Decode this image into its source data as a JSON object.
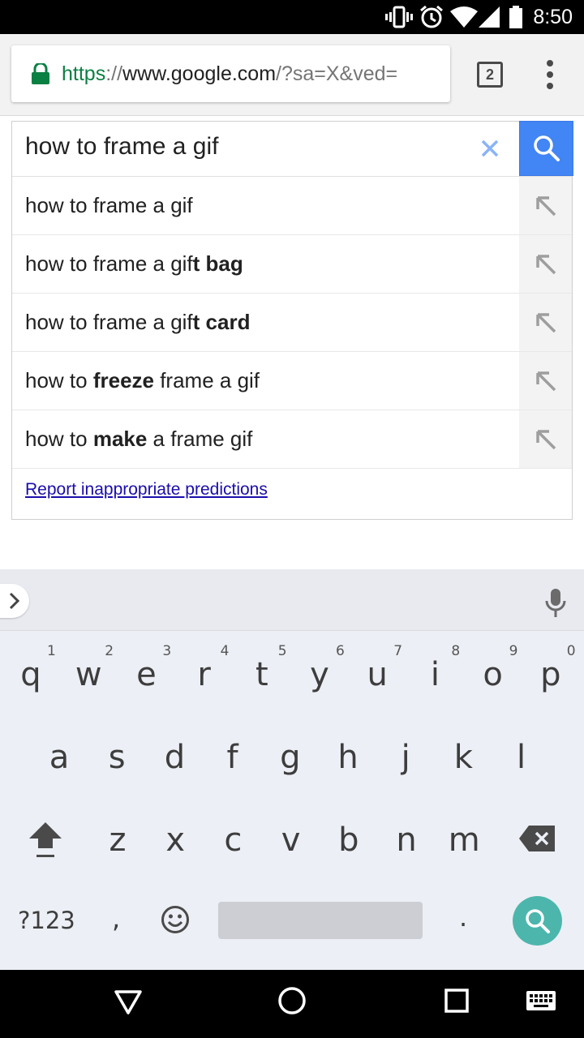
{
  "status_bar": {
    "time": "8:50",
    "icons": [
      "vibrate-icon",
      "alarm-icon",
      "wifi-icon",
      "signal-icon",
      "battery-icon"
    ]
  },
  "toolbar": {
    "url": {
      "scheme": "https",
      "separator": "://",
      "host": "www.google.com",
      "path": "/?sa=X&ved="
    },
    "tab_count": "2",
    "security_color": "#0b8043"
  },
  "search": {
    "query": "how to frame a gif",
    "accent_color": "#4285f4",
    "suggestions": [
      {
        "parts": [
          {
            "text": "how to frame a gif",
            "bold": false
          }
        ]
      },
      {
        "parts": [
          {
            "text": "how to frame a gif",
            "bold": false
          },
          {
            "text": "t bag",
            "bold": true
          }
        ]
      },
      {
        "parts": [
          {
            "text": "how to frame a gif",
            "bold": false
          },
          {
            "text": "t card",
            "bold": true
          }
        ]
      },
      {
        "parts": [
          {
            "text": "how to ",
            "bold": false
          },
          {
            "text": "freeze",
            "bold": true
          },
          {
            "text": " frame a gif",
            "bold": false
          }
        ]
      },
      {
        "parts": [
          {
            "text": "how to ",
            "bold": false
          },
          {
            "text": "make",
            "bold": true
          },
          {
            "text": " a frame gif",
            "bold": false
          }
        ]
      }
    ],
    "report_link": "Report inappropriate predictions"
  },
  "keyboard": {
    "row1": [
      {
        "key": "q",
        "hint": "1"
      },
      {
        "key": "w",
        "hint": "2"
      },
      {
        "key": "e",
        "hint": "3"
      },
      {
        "key": "r",
        "hint": "4"
      },
      {
        "key": "t",
        "hint": "5"
      },
      {
        "key": "y",
        "hint": "6"
      },
      {
        "key": "u",
        "hint": "7"
      },
      {
        "key": "i",
        "hint": "8"
      },
      {
        "key": "o",
        "hint": "9"
      },
      {
        "key": "p",
        "hint": "0"
      }
    ],
    "row2": [
      "a",
      "s",
      "d",
      "f",
      "g",
      "h",
      "j",
      "k",
      "l"
    ],
    "row3": [
      "z",
      "x",
      "c",
      "v",
      "b",
      "n",
      "m"
    ],
    "symbols_key": "?123",
    "comma_key": ",",
    "period_key": ".",
    "action_color": "#4db6ac"
  },
  "nav_bar": {
    "icons": [
      "back-icon",
      "home-icon",
      "recents-icon",
      "keyboard-switch-icon"
    ]
  }
}
